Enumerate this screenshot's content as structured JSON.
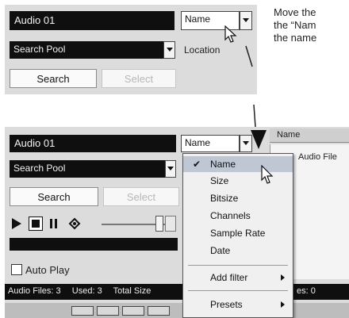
{
  "caption": {
    "lines": [
      "Move the",
      "the “Nam",
      "the name"
    ]
  },
  "top_panel": {
    "name_field": "Audio 01",
    "column_select": "Name",
    "pool_select": "Search Pool",
    "location_label": "Location",
    "search_button": "Search",
    "select_button": "Select"
  },
  "bottom_panel": {
    "name_field": "Audio 01",
    "column_select": "Name",
    "pool_select": "Search Pool",
    "search_button": "Search",
    "select_button": "Select",
    "autoplay_label": "Auto Play",
    "status": {
      "audio_files": "Audio Files: 3",
      "used": "Used: 3",
      "total": "Total Size",
      "tail": "es: 0"
    },
    "results": {
      "column_header": "Name",
      "audio_file_header": "Audio File"
    },
    "menu": {
      "checked_item": "Name",
      "items": [
        "Name",
        "Size",
        "Bitsize",
        "Channels",
        "Sample Rate",
        "Date"
      ],
      "add_filter": "Add filter",
      "presets": "Presets"
    }
  },
  "icons": {
    "play": "play-icon",
    "stop": "stop-icon",
    "pause": "pause-icon",
    "loop": "loop-icon"
  },
  "colors": {
    "panel": "#dcdcdc",
    "field_dark": "#0f0f0f",
    "menu_highlight": "#bfc7d4"
  }
}
